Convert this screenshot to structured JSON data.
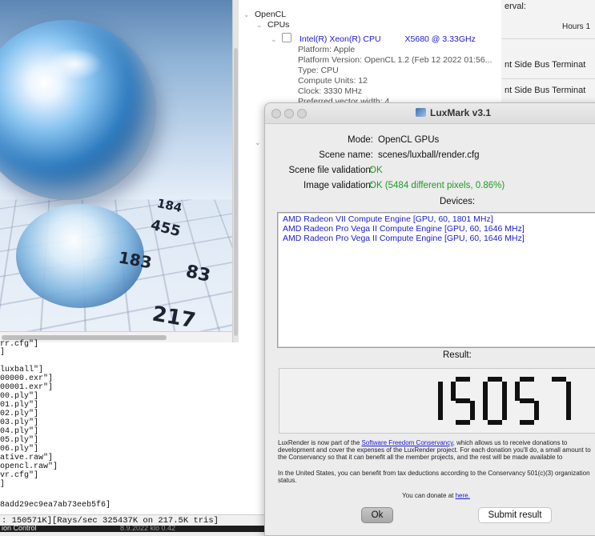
{
  "tree": {
    "root_label": "OpenCL",
    "cpus_label": "CPUs",
    "device": {
      "name": "Intel(R) Xeon(R) CPU",
      "model": "X5680  @ 3.33GHz"
    },
    "props": [
      "Platform: Apple",
      "Platform Version: OpenCL 1.2 (Feb 12 2022 01:56...",
      "Type: CPU",
      "Compute Units: 12",
      "Clock: 3330 MHz",
      "Preferred vector width: 4"
    ]
  },
  "side": {
    "interval_label": "erval:",
    "hours_label": "Hours",
    "hours_value": "1",
    "row1": "nt Side Bus Terminat",
    "row2": "nt Side Bus Terminat"
  },
  "render_numbers": [
    "184",
    "455",
    "183",
    "83",
    "217"
  ],
  "log": {
    "lines": [
      "rr.cfg\"]",
      "]",
      "",
      "luxball\"]",
      "00000.exr\"]",
      "00001.exr\"]",
      "00.ply\"]",
      "01.ply\"]",
      "02.ply\"]",
      "03.ply\"]",
      "04.ply\"]",
      "05.ply\"]",
      "06.ply\"]",
      "ative.raw\"]",
      "opencl.raw\"]",
      "vr.cfg\"]",
      "]",
      "",
      "8add29ec9ea7ab73eeb5f6]"
    ],
    "status": ": 150571K][Rays/sec  325437K on 217.5K tris]",
    "dock_left": "ion Control",
    "dock_right": "8.9.2022 klo 0.42"
  },
  "dialog": {
    "title": "LuxMark v3.1",
    "mode_label": "Mode:",
    "mode_value": "OpenCL GPUs",
    "scene_label": "Scene name:",
    "scene_value": "scenes/luxball/render.cfg",
    "scenefile_label": "Scene file validation:",
    "scenefile_value": "OK",
    "image_label": "Image validation:",
    "image_value": "OK (5484 different pixels, 0.86%)",
    "devices_label": "Devices:",
    "devices": [
      "AMD Radeon VII Compute Engine [GPU, 60, 1801 MHz]",
      "AMD Radeon Pro Vega II Compute Engine [GPU, 60, 1646 MHz]",
      "AMD Radeon Pro Vega II Compute Engine [GPU, 60, 1646 MHz]"
    ],
    "result_label": "Result:",
    "result_value": "150571",
    "info_pre": "LuxRender is now part of the ",
    "info_link": "Software Freedom Conservancy",
    "info_post": ", which allows us to receive donations to development and cover the expenses of the LuxRender project. For each donation you'll do, a small amount to the Conservancy so that it can benefit all the member projects, and the rest will be made available to",
    "tax_text": "In the United States, you can benefit from tax deductions according to the Conservancy 501(c)(3) organization status.",
    "donate_pre": "You can donate at ",
    "donate_link": "here.",
    "ok_label": "Ok",
    "submit_label": "Submit result"
  }
}
